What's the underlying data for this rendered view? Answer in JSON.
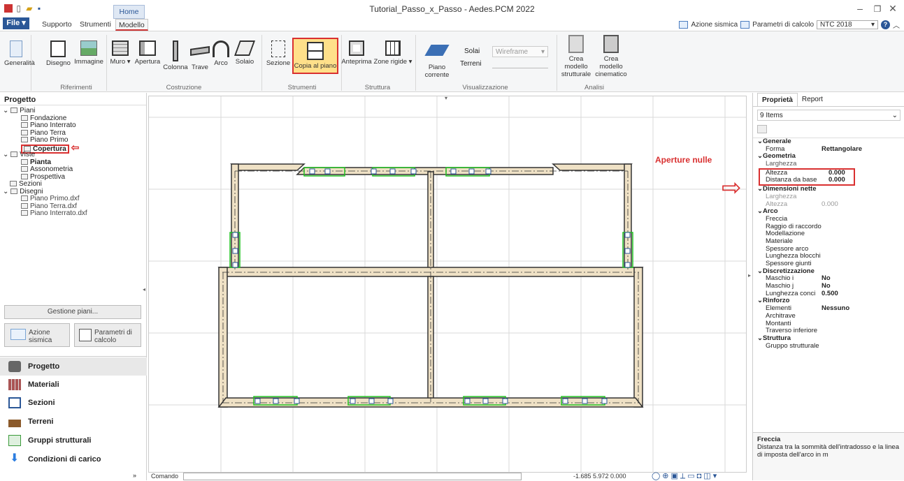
{
  "app": {
    "title": "Tutorial_Passo_x_Passo - Aedes.PCM 2022"
  },
  "menu": {
    "file": "File",
    "home": "Home",
    "tabs": [
      "Supporto",
      "Strumenti",
      "Modello"
    ]
  },
  "right_controls": {
    "azione": "Azione sismica",
    "parametri": "Parametri di calcolo",
    "norm": "NTC 2018"
  },
  "ribbon": {
    "buttons": [
      "Generalità",
      "Disegno",
      "Immagine",
      "Muro",
      "Apertura",
      "Colonna",
      "Trave",
      "Arco",
      "Solaio",
      "Sezione",
      "Copia al piano",
      "Anteprima",
      "Zone rigide",
      "Piano corrente",
      "Solai",
      "Terreni",
      "Wireframe",
      "Crea modello strutturale",
      "Crea modello cinematico"
    ],
    "groups": [
      "Riferimenti",
      "Costruzione",
      "Strumenti",
      "Struttura",
      "Visualizzazione",
      "Analisi"
    ]
  },
  "left": {
    "title": "Progetto",
    "tree": [
      "Piani",
      "Fondazione",
      "Piano Interrato",
      "Piano Terra",
      "Piano Primo",
      "Copertura",
      "Viste",
      "Pianta",
      "Assonometria",
      "Prospettiva",
      "Sezioni",
      "Disegni",
      "Piano Primo.dxf",
      "Piano Terra.dxf",
      "Piano Interrato.dxf"
    ],
    "gestione": "Gestione piani...",
    "azione": "Azione sismica",
    "parametri": "Parametri di calcolo",
    "nav": [
      "Progetto",
      "Materiali",
      "Sezioni",
      "Terreni",
      "Gruppi strutturali",
      "Condizioni di carico"
    ]
  },
  "canvas": {
    "annotation": "Aperture nulle",
    "command_label": "Comando",
    "coords": "-1.685  5.972  0.000"
  },
  "right": {
    "tabs": [
      "Proprietà",
      "Report"
    ],
    "count": "9 Items",
    "groups": {
      "generale": "Generale",
      "geometria": "Geometria",
      "dimensioni": "Dimensioni nette",
      "arco": "Arco",
      "discretizzazione": "Discretizzazione",
      "rinforzo": "Rinforzo",
      "struttura": "Struttura"
    },
    "rows": {
      "forma": [
        "Forma",
        "Rettangolare"
      ],
      "larghezza": [
        "Larghezza",
        ""
      ],
      "altezza": [
        "Altezza",
        "0.000"
      ],
      "distanza": [
        "Distanza da base",
        "0.000"
      ],
      "n_larghezza": [
        "Larghezza",
        ""
      ],
      "n_altezza": [
        "Altezza",
        "0.000"
      ],
      "freccia": [
        "Freccia",
        ""
      ],
      "raggio": [
        "Raggio di raccordo",
        ""
      ],
      "modellazione": [
        "Modellazione",
        ""
      ],
      "materiale": [
        "Materiale",
        ""
      ],
      "spessore": [
        "Spessore arco",
        ""
      ],
      "lunghezza_blocchi": [
        "Lunghezza blocchi",
        ""
      ],
      "spessore_giunti": [
        "Spessore giunti",
        ""
      ],
      "maschio_i": [
        "Maschio i",
        "No"
      ],
      "maschio_j": [
        "Maschio j",
        "No"
      ],
      "conci": [
        "Lunghezza conci",
        "0.500"
      ],
      "elementi": [
        "Elementi",
        "Nessuno"
      ],
      "architrave": [
        "Architrave",
        ""
      ],
      "montanti": [
        "Montanti",
        ""
      ],
      "traverso": [
        "Traverso inferiore",
        ""
      ],
      "gruppo": [
        "Gruppo strutturale",
        ""
      ]
    },
    "help_title": "Freccia",
    "help_text": "Distanza tra la sommità dell'intradosso e la linea di imposta dell'arco in m"
  },
  "colors": {
    "accent": "#2b5797",
    "highlight": "#d93030",
    "wall": "#efe1c5",
    "opening": "#21c021"
  }
}
